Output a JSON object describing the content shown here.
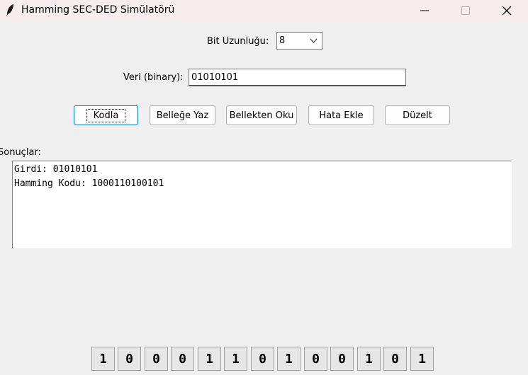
{
  "window": {
    "title": "Hamming SEC-DED Simülatörü",
    "controls": {
      "minimize": "—",
      "maximize": "☐",
      "close": "✕"
    }
  },
  "bit_length": {
    "label": "Bit Uzunluğu:",
    "value": "8"
  },
  "data_input": {
    "label": "Veri (binary):",
    "value": "01010101"
  },
  "buttons": {
    "encode": "Kodla",
    "write_memory": "Belleğe Yaz",
    "read_memory": "Bellekten Oku",
    "add_error": "Hata Ekle",
    "fix": "Düzelt"
  },
  "results": {
    "label": "Sonuçlar:",
    "lines": [
      "Girdi: 01010101",
      "Hamming Kodu: 1000110100101"
    ]
  },
  "bits": [
    "1",
    "0",
    "0",
    "0",
    "1",
    "1",
    "0",
    "1",
    "0",
    "0",
    "1",
    "0",
    "1"
  ]
}
